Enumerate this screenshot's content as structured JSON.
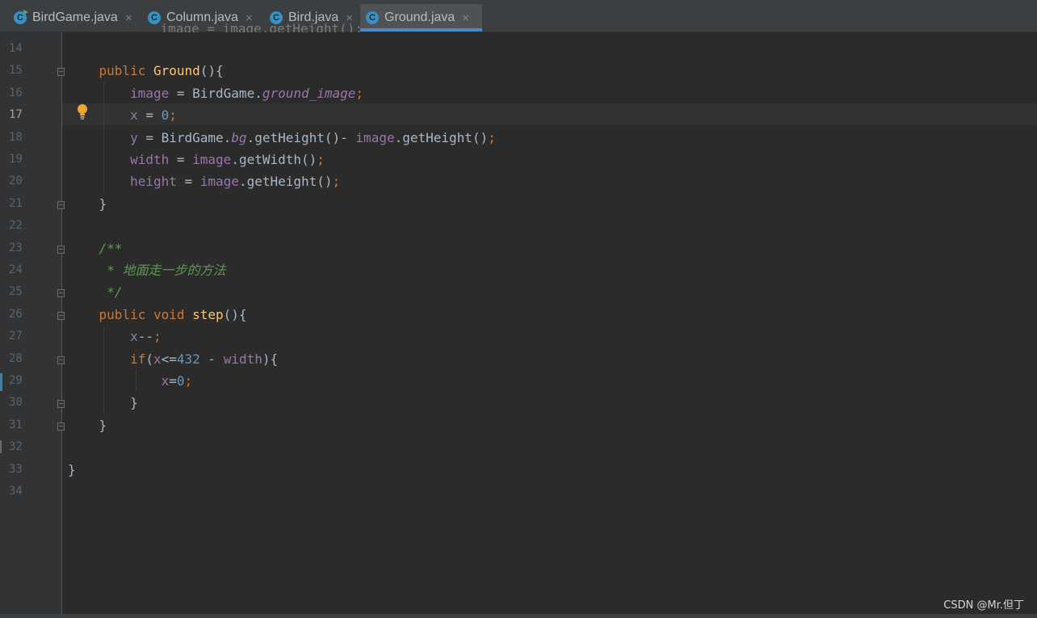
{
  "tabs": [
    {
      "label": "BirdGame.java",
      "icon": "java-class-runnable-icon",
      "active": false
    },
    {
      "label": "Column.java",
      "icon": "java-class-icon",
      "active": false
    },
    {
      "label": "Bird.java",
      "icon": "java-class-icon",
      "active": false
    },
    {
      "label": "Ground.java",
      "icon": "java-class-icon",
      "active": true
    }
  ],
  "tab_close_glyph": "×",
  "class_icon_letter": "C",
  "partial_top_line": "    image = image.getHeight();",
  "current_line": 17,
  "line_numbers": [
    "14",
    "15",
    "16",
    "17",
    "18",
    "19",
    "20",
    "21",
    "22",
    "23",
    "24",
    "25",
    "26",
    "27",
    "28",
    "29",
    "30",
    "31",
    "32",
    "33",
    "34"
  ],
  "code_lines": [
    {
      "n": 14,
      "tokens": []
    },
    {
      "n": 15,
      "tokens": [
        [
          "    ",
          "plain"
        ],
        [
          "public ",
          "kw"
        ],
        [
          "Ground",
          "fn"
        ],
        [
          "(){",
          "plain"
        ]
      ]
    },
    {
      "n": 16,
      "tokens": [
        [
          "        ",
          "plain"
        ],
        [
          "image",
          "field"
        ],
        [
          " = BirdGame.",
          "plain"
        ],
        [
          "ground_image",
          "static"
        ],
        [
          ";",
          "semi"
        ]
      ]
    },
    {
      "n": 17,
      "tokens": [
        [
          "        ",
          "plain"
        ],
        [
          "x",
          "field"
        ],
        [
          " = ",
          "plain"
        ],
        [
          "0",
          "num"
        ],
        [
          ";",
          "semi"
        ]
      ]
    },
    {
      "n": 18,
      "tokens": [
        [
          "        ",
          "plain"
        ],
        [
          "y",
          "field"
        ],
        [
          " = BirdGame.",
          "plain"
        ],
        [
          "bg",
          "static"
        ],
        [
          ".getHeight()- ",
          "plain"
        ],
        [
          "image",
          "field"
        ],
        [
          ".getHeight()",
          "plain"
        ],
        [
          ";",
          "semi"
        ]
      ]
    },
    {
      "n": 19,
      "tokens": [
        [
          "        ",
          "plain"
        ],
        [
          "width",
          "field"
        ],
        [
          " = ",
          "plain"
        ],
        [
          "image",
          "field"
        ],
        [
          ".getWidth()",
          "plain"
        ],
        [
          ";",
          "semi"
        ]
      ]
    },
    {
      "n": 20,
      "tokens": [
        [
          "        ",
          "plain"
        ],
        [
          "height",
          "field"
        ],
        [
          " = ",
          "plain"
        ],
        [
          "image",
          "field"
        ],
        [
          ".getHeight()",
          "plain"
        ],
        [
          ";",
          "semi"
        ]
      ]
    },
    {
      "n": 21,
      "tokens": [
        [
          "    }",
          "plain"
        ]
      ]
    },
    {
      "n": 22,
      "tokens": []
    },
    {
      "n": 23,
      "tokens": [
        [
          "    ",
          "plain"
        ],
        [
          "/**",
          "comment"
        ]
      ]
    },
    {
      "n": 24,
      "tokens": [
        [
          "     ",
          "plain"
        ],
        [
          "* 地面走一步的方法",
          "comment"
        ]
      ]
    },
    {
      "n": 25,
      "tokens": [
        [
          "     ",
          "plain"
        ],
        [
          "*/",
          "comment"
        ]
      ]
    },
    {
      "n": 26,
      "tokens": [
        [
          "    ",
          "plain"
        ],
        [
          "public void ",
          "kw"
        ],
        [
          "step",
          "fn"
        ],
        [
          "(){",
          "plain"
        ]
      ]
    },
    {
      "n": 27,
      "tokens": [
        [
          "        ",
          "plain"
        ],
        [
          "x",
          "field"
        ],
        [
          "--",
          "plain"
        ],
        [
          ";",
          "semi"
        ]
      ]
    },
    {
      "n": 28,
      "tokens": [
        [
          "        ",
          "plain"
        ],
        [
          "if",
          "kw"
        ],
        [
          "(",
          "plain"
        ],
        [
          "x",
          "field"
        ],
        [
          "<=",
          "plain"
        ],
        [
          "432",
          "num"
        ],
        [
          " - ",
          "plain"
        ],
        [
          "width",
          "field"
        ],
        [
          "){",
          "plain"
        ]
      ]
    },
    {
      "n": 29,
      "tokens": [
        [
          "            ",
          "plain"
        ],
        [
          "x",
          "field"
        ],
        [
          "=",
          "plain"
        ],
        [
          "0",
          "num"
        ],
        [
          ";",
          "semi"
        ]
      ]
    },
    {
      "n": 30,
      "tokens": [
        [
          "        }",
          "plain"
        ]
      ]
    },
    {
      "n": 31,
      "tokens": [
        [
          "    }",
          "plain"
        ]
      ]
    },
    {
      "n": 32,
      "tokens": []
    },
    {
      "n": 33,
      "tokens": [
        [
          "}",
          "plain"
        ]
      ]
    },
    {
      "n": 34,
      "tokens": []
    }
  ],
  "fold_markers_on_lines": [
    15,
    21,
    23,
    25,
    26,
    28,
    30,
    31
  ],
  "bulb_icon": "intention-bulb-icon",
  "colors": {
    "keyword": "#cc7832",
    "method": "#ffc66d",
    "field": "#9876aa",
    "number": "#6897bb",
    "comment": "#629755",
    "text": "#a9b7c6",
    "background": "#2b2b2b",
    "active_tab_accent": "#4a88c7"
  },
  "watermark": "CSDN @Mr.但丁"
}
